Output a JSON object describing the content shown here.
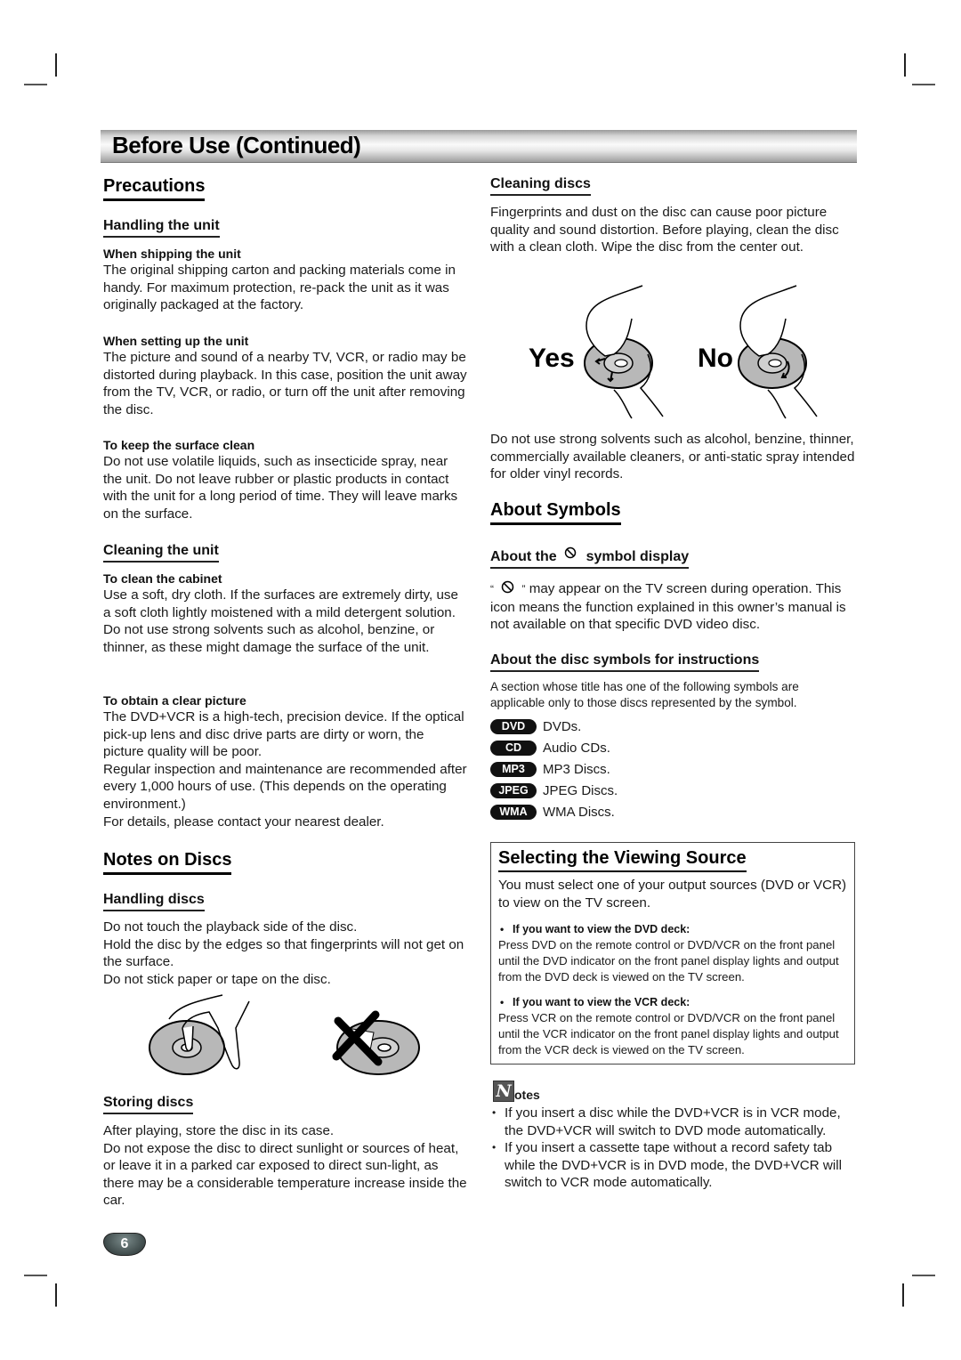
{
  "banner": {
    "title": "Before Use (Continued)"
  },
  "left": {
    "precautions": {
      "title": "Precautions",
      "handling_unit": {
        "title": "Handling the unit",
        "shipping": {
          "title": "When shipping the unit",
          "text": "The original shipping carton and packing materials come in handy. For maximum protection, re-pack the unit as it was originally packaged at the factory."
        },
        "setting_up": {
          "title": "When setting up the unit",
          "text": "The picture and sound of a nearby TV, VCR, or radio may be distorted during playback. In this case, position the unit away from the TV, VCR, or radio, or turn off the unit after removing the disc."
        },
        "surface": {
          "title": "To keep the surface clean",
          "text": "Do not use volatile liquids, such as insecticide spray, near the unit. Do not leave rubber or plastic products in contact with the unit for a long period of time. They will leave marks on the surface."
        }
      },
      "cleaning_unit": {
        "title": "Cleaning the unit",
        "cabinet": {
          "title": "To clean the cabinet",
          "text": "Use a soft, dry cloth. If the surfaces are extremely dirty, use a soft cloth lightly moistened with a mild detergent solution. Do not use strong solvents such as alcohol, benzine, or thinner, as these might damage the surface of the unit."
        },
        "clear_picture": {
          "title": "To obtain a clear picture",
          "text1": "The DVD+VCR is a high-tech, precision device. If the optical pick-up lens and disc drive parts are dirty or worn, the picture quality will be poor.",
          "text2": "Regular inspection and maintenance are recommended after every 1,000 hours of use. (This depends on the operating environment.)",
          "text3": "For details, please contact your nearest dealer."
        }
      }
    },
    "notes_on_discs": {
      "title": "Notes on Discs",
      "handling_discs": {
        "title": "Handling discs",
        "line1": "Do not touch the playback side of the disc.",
        "line2": "Hold the disc by the edges so that fingerprints will not get on the surface.",
        "line3": "Do not stick paper or tape on the disc."
      },
      "storing_discs": {
        "title": "Storing discs",
        "line1": "After playing, store the disc in its case.",
        "line2": "Do not expose the disc to direct sunlight or sources of heat, or leave it in a parked car exposed to direct sun-light, as there may be a considerable temperature increase inside the car."
      }
    }
  },
  "right": {
    "cleaning_discs": {
      "title": "Cleaning discs",
      "text": "Fingerprints and dust on the disc can cause poor picture quality and sound distortion. Before playing, clean the disc with a clean cloth. Wipe the disc from the center out.",
      "yes_label": "Yes",
      "no_label": "No",
      "warning": "Do not use strong solvents such as alcohol, benzine, thinner, commercially available cleaners, or anti-static spray intended for older vinyl records."
    },
    "about_symbols": {
      "title": "About Symbols",
      "symbol_display": {
        "title_prefix": "About the",
        "title_suffix": "symbol display",
        "quote_open": "“",
        "quote_close": "”",
        "text": "may appear on the TV screen during operation. This icon means the function explained in this owner’s manual is not available on that specific DVD video disc."
      },
      "disc_symbols": {
        "title": "About the disc symbols for instructions",
        "intro": "A section whose title has one of the following symbols are applicable only to those discs represented by the symbol.",
        "items": [
          {
            "badge": "DVD",
            "label": "DVDs."
          },
          {
            "badge": "CD",
            "label": "Audio CDs."
          },
          {
            "badge": "MP3",
            "label": "MP3 Discs."
          },
          {
            "badge": "JPEG",
            "label": "JPEG Discs."
          },
          {
            "badge": "WMA",
            "label": "WMA Discs."
          }
        ]
      }
    },
    "viewing_source": {
      "title": "Selecting the Viewing Source",
      "intro": "You must select one of your output sources (DVD or VCR) to view on the TV screen.",
      "dvd": {
        "title": "If you want to view the DVD deck:",
        "text": "Press DVD on the remote control or DVD/VCR on the front panel until the DVD indicator on the front panel display lights and output from the DVD deck is viewed on the TV screen."
      },
      "vcr": {
        "title": "If you want to view the VCR deck:",
        "text": "Press VCR on the remote control or DVD/VCR on the front panel until the VCR indicator on the front panel display lights and output from the VCR deck is viewed on the TV screen."
      }
    },
    "notes": {
      "icon_letter": "N",
      "title_rest": "otes",
      "items": [
        "If you insert a disc while the DVD+VCR is in VCR mode, the DVD+VCR will switch to DVD mode automatically.",
        "If you insert a cassette tape without a record safety tab while the DVD+VCR is in DVD mode, the DVD+VCR will switch to VCR mode automatically."
      ]
    }
  },
  "footer": {
    "page_number": "6"
  }
}
